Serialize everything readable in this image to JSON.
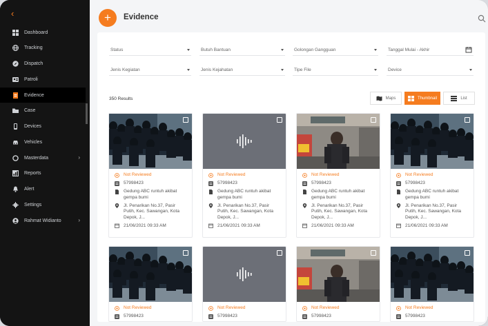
{
  "sidebar": {
    "items": [
      {
        "label": "Dashboard",
        "icon": "dashboard-icon"
      },
      {
        "label": "Tracking",
        "icon": "globe-icon"
      },
      {
        "label": "Dispatch",
        "icon": "compass-icon"
      },
      {
        "label": "Patroli",
        "icon": "id-card-icon"
      },
      {
        "label": "Evidence",
        "icon": "document-icon",
        "active": true
      },
      {
        "label": "Case",
        "icon": "folder-icon"
      },
      {
        "label": "Devices",
        "icon": "phone-icon"
      },
      {
        "label": "Vehicles",
        "icon": "car-icon"
      },
      {
        "label": "Masterdata",
        "icon": "circle-icon",
        "has_submenu": true
      },
      {
        "label": "Reports",
        "icon": "chart-icon"
      },
      {
        "label": "Alert",
        "icon": "bell-icon"
      },
      {
        "label": "Settings",
        "icon": "gear-icon"
      },
      {
        "label": "Rahmat Widianto",
        "icon": "user-icon",
        "has_submenu": true
      }
    ]
  },
  "header": {
    "title": "Evidence",
    "add_label": "+"
  },
  "filters": {
    "status": "Status",
    "butuh_bantuan": "Butuh Bantuan",
    "golongan_gangguan": "Golongan Gangguan",
    "tanggal": "Tanggal Mulai - Akhir",
    "jenis_kegiatan": "Jenis Kegiatan",
    "jenis_kejahatan": "Jenis Kejahatan",
    "tipe_file": "Tipe File",
    "device": "Device"
  },
  "results": {
    "count_label": "350 Results"
  },
  "view_toggle": {
    "maps": "Maps",
    "thumbnail": "Thumbnail",
    "list": "List"
  },
  "cards": [
    {
      "type": "crowd",
      "status": "Not Reviewed",
      "id": "57998423",
      "title": "Gedung ABC runtuh akibat gempa bumi",
      "address": "Jl. Penarikan No.37, Pasir Putih, Kec. Sawangan, Kota Depok, J...",
      "datetime": "21/06/2021 09:33 AM"
    },
    {
      "type": "audio",
      "status": "Not Reviewed",
      "id": "57998423",
      "title": "Gedung ABC runtuh akibat gempa bumi",
      "address": "Jl. Penarikan No.37, Pasir Putih, Kec. Sawangan, Kota Depok, J...",
      "datetime": "21/06/2021 09:33 AM"
    },
    {
      "type": "officer",
      "status": "Not Reviewed",
      "id": "57998423",
      "title": "Gedung ABC runtuh akibat gempa bumi",
      "address": "Jl. Penarikan No.37, Pasir Putih, Kec. Sawangan, Kota Depok, J...",
      "datetime": "21/06/2021 09:33 AM"
    },
    {
      "type": "crowd",
      "status": "Not Reviewed",
      "id": "57998423",
      "title": "Gedung ABC runtuh akibat gempa bumi",
      "address": "Jl. Penarikan No.37, Pasir Putih, Kec. Sawangan, Kota Depok, J...",
      "datetime": "21/06/2021 09:33 AM"
    },
    {
      "type": "crowd",
      "status": "Not Reviewed",
      "id": "57998423"
    },
    {
      "type": "audio",
      "status": "Not Reviewed",
      "id": "57998423"
    },
    {
      "type": "officer",
      "status": "Not Reviewed",
      "id": "57998423"
    },
    {
      "type": "crowd",
      "status": "Not Reviewed",
      "id": "57998423"
    }
  ],
  "colors": {
    "accent": "#f57c1f",
    "sidebar_bg": "#141414",
    "audio_bg": "#6c6f77"
  }
}
